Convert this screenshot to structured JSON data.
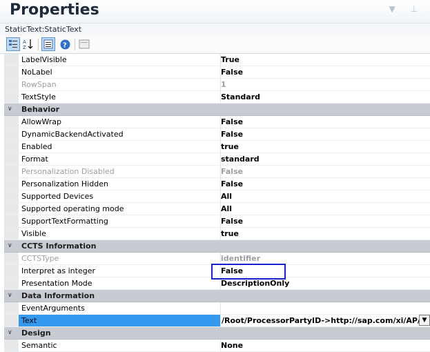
{
  "header": {
    "title": "Properties",
    "object_label": "StaticText:StaticText"
  },
  "toolbar": {
    "icons": [
      "categorized-icon",
      "alphabetical-icon",
      "properties-icon",
      "help-icon",
      "pages-icon"
    ]
  },
  "grid": {
    "top_rows": [
      {
        "name": "LabelVisible",
        "value": "True",
        "disabled": false
      },
      {
        "name": "NoLabel",
        "value": "False",
        "disabled": false
      },
      {
        "name": "RowSpan",
        "value": "1",
        "disabled": true
      },
      {
        "name": "TextStyle",
        "value": "Standard",
        "disabled": false
      }
    ],
    "behavior": {
      "label": "Behavior",
      "rows": [
        {
          "name": "AllowWrap",
          "value": "False",
          "disabled": false
        },
        {
          "name": "DynamicBackendActivated",
          "value": "False",
          "disabled": false
        },
        {
          "name": "Enabled",
          "value": "true",
          "disabled": false
        },
        {
          "name": "Format",
          "value": "standard",
          "disabled": false
        },
        {
          "name": "Personalization Disabled",
          "value": "False",
          "disabled": true
        },
        {
          "name": "Personalization Hidden",
          "value": "False",
          "disabled": false
        },
        {
          "name": "Supported Devices",
          "value": "All",
          "disabled": false
        },
        {
          "name": "Supported operating mode",
          "value": "All",
          "disabled": false
        },
        {
          "name": "SupportTextFormatting",
          "value": "False",
          "disabled": false
        },
        {
          "name": "Visible",
          "value": "true",
          "disabled": false
        }
      ]
    },
    "ccts": {
      "label": "CCTS Information",
      "rows": [
        {
          "name": "CCTSType",
          "value": "identifier",
          "disabled": true
        },
        {
          "name": "Interpret as integer",
          "value": "False",
          "disabled": false
        },
        {
          "name": "Presentation Mode",
          "value": "DescriptionOnly",
          "disabled": false
        }
      ]
    },
    "data_info": {
      "label": "Data Information",
      "rows": [
        {
          "name": "EventArguments",
          "value": ""
        },
        {
          "name": "Text",
          "value": "/Root/ProcessorPartyID->http://sap.com/xi/AP/("
        }
      ]
    },
    "design": {
      "label": "Design",
      "rows": [
        {
          "name": "Semantic",
          "value": "None"
        }
      ]
    }
  }
}
